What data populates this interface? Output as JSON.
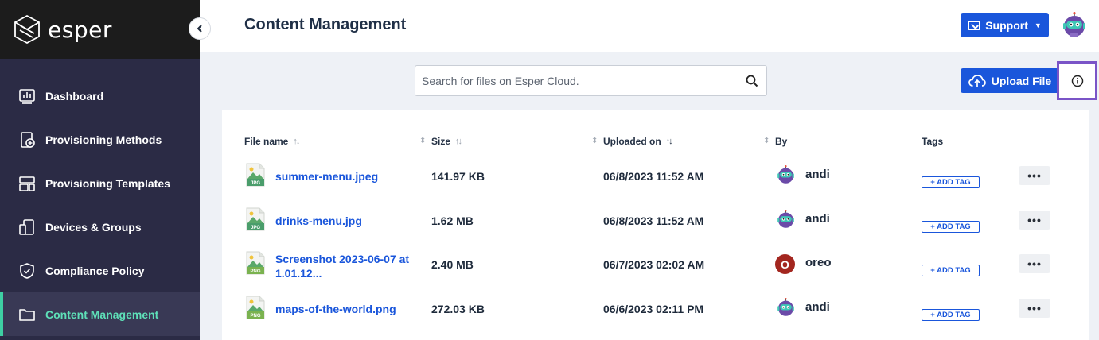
{
  "brand": {
    "name": "esper"
  },
  "header": {
    "title": "Content Management",
    "support_label": "Support"
  },
  "sidebar": {
    "items": [
      {
        "label": "Dashboard",
        "icon": "dashboard-icon"
      },
      {
        "label": "Provisioning Methods",
        "icon": "provisioning-methods-icon"
      },
      {
        "label": "Provisioning Templates",
        "icon": "provisioning-templates-icon"
      },
      {
        "label": "Devices & Groups",
        "icon": "devices-icon"
      },
      {
        "label": "Compliance Policy",
        "icon": "shield-icon"
      },
      {
        "label": "Content Management",
        "icon": "folder-icon",
        "active": true
      }
    ]
  },
  "toolbar": {
    "search_placeholder": "Search for files on Esper Cloud.",
    "upload_label": "Upload File"
  },
  "table": {
    "columns": [
      "File name",
      "Size",
      "Uploaded on",
      "By",
      "Tags"
    ],
    "add_tag_label": "+ ADD TAG",
    "more_label": "•••",
    "rows": [
      {
        "file_name": "summer-menu.jpeg",
        "file_name_line2": "",
        "file_type": "JPG",
        "size": "141.97 KB",
        "uploaded_on": "06/8/2023 11:52 AM",
        "by": "andi",
        "avatar": "robot",
        "avatar_letter": ""
      },
      {
        "file_name": "drinks-menu.jpg",
        "file_name_line2": "",
        "file_type": "JPG",
        "size": "1.62 MB",
        "uploaded_on": "06/8/2023 11:52 AM",
        "by": "andi",
        "avatar": "robot",
        "avatar_letter": ""
      },
      {
        "file_name": "Screenshot 2023-06-07 at",
        "file_name_line2": "1.01.12...",
        "file_type": "PNG",
        "size": "2.40 MB",
        "uploaded_on": "06/7/2023 02:02 AM",
        "by": "oreo",
        "avatar": "letter",
        "avatar_letter": "O"
      },
      {
        "file_name": "maps-of-the-world.png",
        "file_name_line2": "",
        "file_type": "PNG",
        "size": "272.03 KB",
        "uploaded_on": "06/6/2023 02:11 PM",
        "by": "andi",
        "avatar": "robot",
        "avatar_letter": ""
      }
    ]
  },
  "colors": {
    "primary": "#1a56db",
    "sidebar": "#2b2b45",
    "active_accent": "#3ecfa3",
    "highlight": "#7a54c7",
    "oreo_avatar": "#a3261f"
  }
}
